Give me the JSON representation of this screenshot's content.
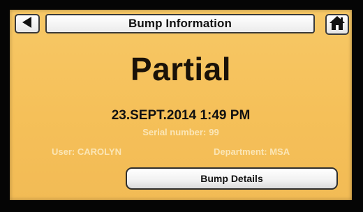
{
  "header": {
    "title": "Bump Information",
    "back_icon": "left-arrow-icon",
    "home_icon": "home-icon"
  },
  "status": {
    "result": "Partial"
  },
  "info": {
    "datetime": "23.SEPT.2014 1:49 PM",
    "serial_label": "Serial number:",
    "serial_value": "99",
    "user_label": "User:",
    "user_value": "CAROLYN",
    "department_label": "Department:",
    "department_value": "MSA"
  },
  "actions": {
    "details_label": "Bump Details"
  },
  "colors": {
    "screen_background": "#f5c059",
    "secondary_text": "#fbe6b6"
  }
}
